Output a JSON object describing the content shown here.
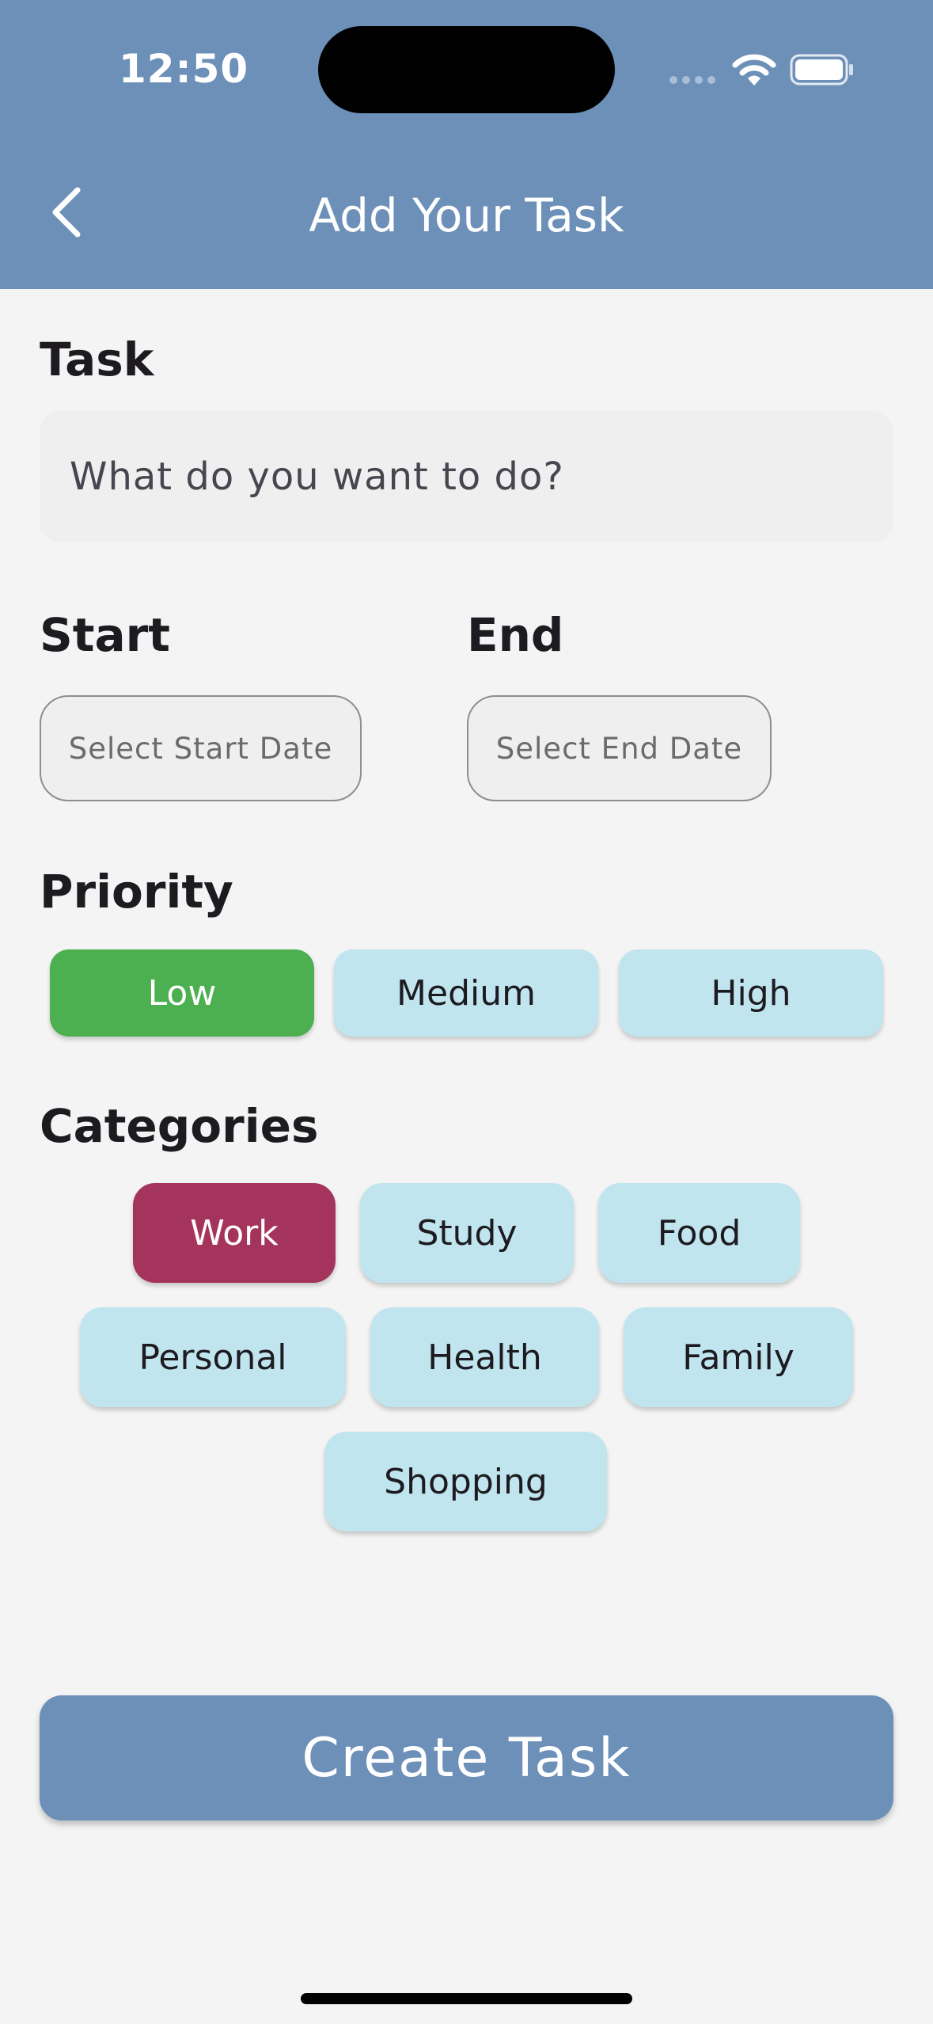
{
  "status_bar": {
    "time": "12:50"
  },
  "header": {
    "title": "Add Your Task",
    "back_icon": "chevron-left-icon",
    "background": "#6d90b9"
  },
  "task": {
    "label": "Task",
    "placeholder": "What do you want to do?",
    "value": ""
  },
  "dates": {
    "start_label": "Start",
    "start_button": "Select Start Date",
    "end_label": "End",
    "end_button": "Select End Date"
  },
  "priority": {
    "label": "Priority",
    "options": [
      "Low",
      "Medium",
      "High"
    ],
    "selected": "Low",
    "selected_color": "#4caf50"
  },
  "categories": {
    "label": "Categories",
    "options": [
      "Work",
      "Study",
      "Food",
      "Personal",
      "Health",
      "Family",
      "Shopping"
    ],
    "selected": "Work",
    "selected_color": "#a5345c",
    "unselected_color": "#c0e5ef"
  },
  "create_button": {
    "label": "Create Task",
    "color": "#6d90b9"
  }
}
